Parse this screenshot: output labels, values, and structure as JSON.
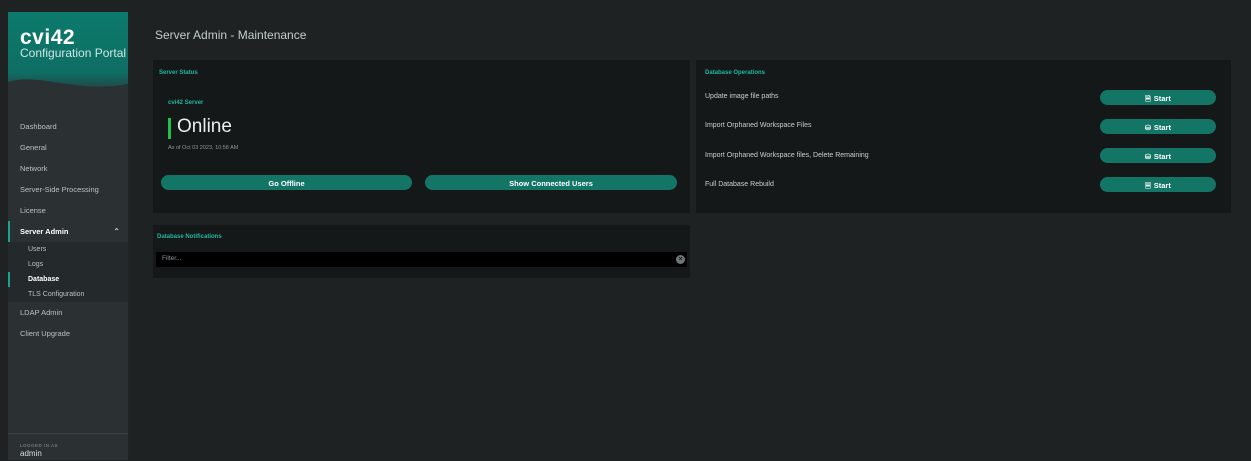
{
  "sidebar": {
    "brand_name": "cvi42",
    "brand_subtitle": "Configuration Portal",
    "items": [
      {
        "label": "Dashboard"
      },
      {
        "label": "General"
      },
      {
        "label": "Network"
      },
      {
        "label": "Server-Side Processing"
      },
      {
        "label": "License"
      },
      {
        "label": "Server Admin",
        "expanded": true
      },
      {
        "label": "LDAP Admin"
      },
      {
        "label": "Client Upgrade"
      }
    ],
    "sub_items": [
      {
        "label": "Users"
      },
      {
        "label": "Logs"
      },
      {
        "label": "Database",
        "active": true
      },
      {
        "label": "TLS Configuration"
      }
    ],
    "logged_in_label": "LOGGED IN AS",
    "logged_in_user": "admin"
  },
  "header": {
    "title": "Server Admin - Maintenance"
  },
  "server_status": {
    "title": "Server Status",
    "server_label": "cvi42 Server",
    "status": "Online",
    "status_color": "#1fc24a",
    "timestamp": "As of Oct 03 2023, 10:58 AM",
    "go_offline_label": "Go Offline",
    "show_users_label": "Show Connected Users"
  },
  "database_operations": {
    "title": "Database Operations",
    "operations": [
      {
        "label": "Update image file paths",
        "button": "Start",
        "icon": "file-icon"
      },
      {
        "label": "Import Orphaned Workspace Files",
        "button": "Start",
        "icon": "database-icon"
      },
      {
        "label": "Import Orphaned Workspace files, Delete Remaining",
        "button": "Start",
        "icon": "database-icon"
      },
      {
        "label": "Full Database Rebuild",
        "button": "Start",
        "icon": "rebuild-icon"
      }
    ]
  },
  "notifications": {
    "title": "Database Notifications",
    "filter_placeholder": "Filter..."
  },
  "colors": {
    "accent": "#1fb8a0",
    "button": "#137565",
    "panel": "#141818",
    "background": "#1e2222"
  }
}
